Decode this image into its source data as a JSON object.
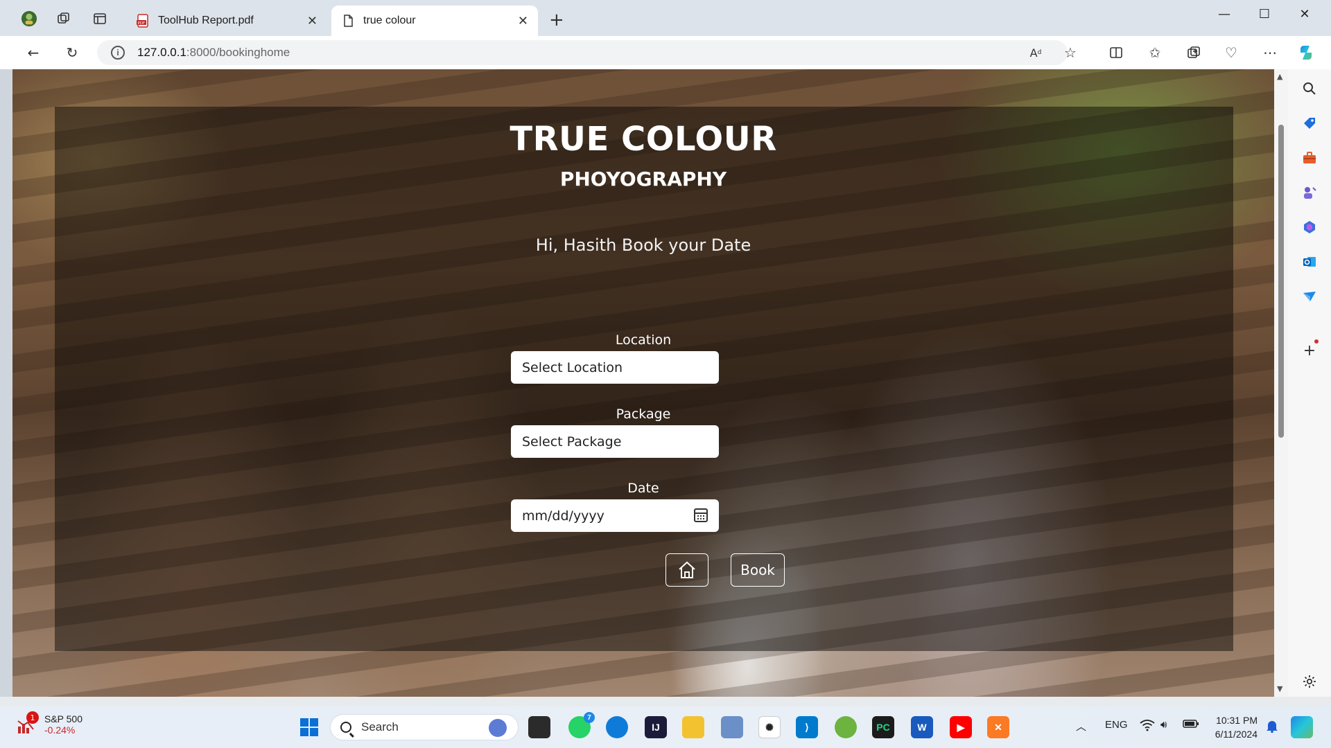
{
  "browser": {
    "tabs": [
      {
        "label": "ToolHub Report.pdf",
        "active": false
      },
      {
        "label": "true colour",
        "active": true
      }
    ],
    "address": {
      "host": "127.0.0.1",
      "path": ":8000/bookinghome"
    }
  },
  "page": {
    "title": "TRUE COLOUR",
    "subtitle": "PHOYOGRAPHY",
    "greeting": "Hi, Hasith Book your Date",
    "location": {
      "label": "Location",
      "placeholder": "Select Location"
    },
    "package": {
      "label": "Package",
      "placeholder": "Select Package"
    },
    "date": {
      "label": "Date",
      "placeholder": "mm/dd/yyyy"
    },
    "book_label": "Book"
  },
  "taskbar": {
    "stock_name": "S&P 500",
    "stock_change": "-0.24%",
    "stock_badge": "1",
    "search_label": "Search",
    "whatsapp_badge": "7",
    "language": "ENG",
    "time": "10:31 PM",
    "date": "6/11/2024"
  },
  "colors": {
    "overlay": "#000000",
    "accent": "#0078d4",
    "stock_negative": "#c62828"
  }
}
